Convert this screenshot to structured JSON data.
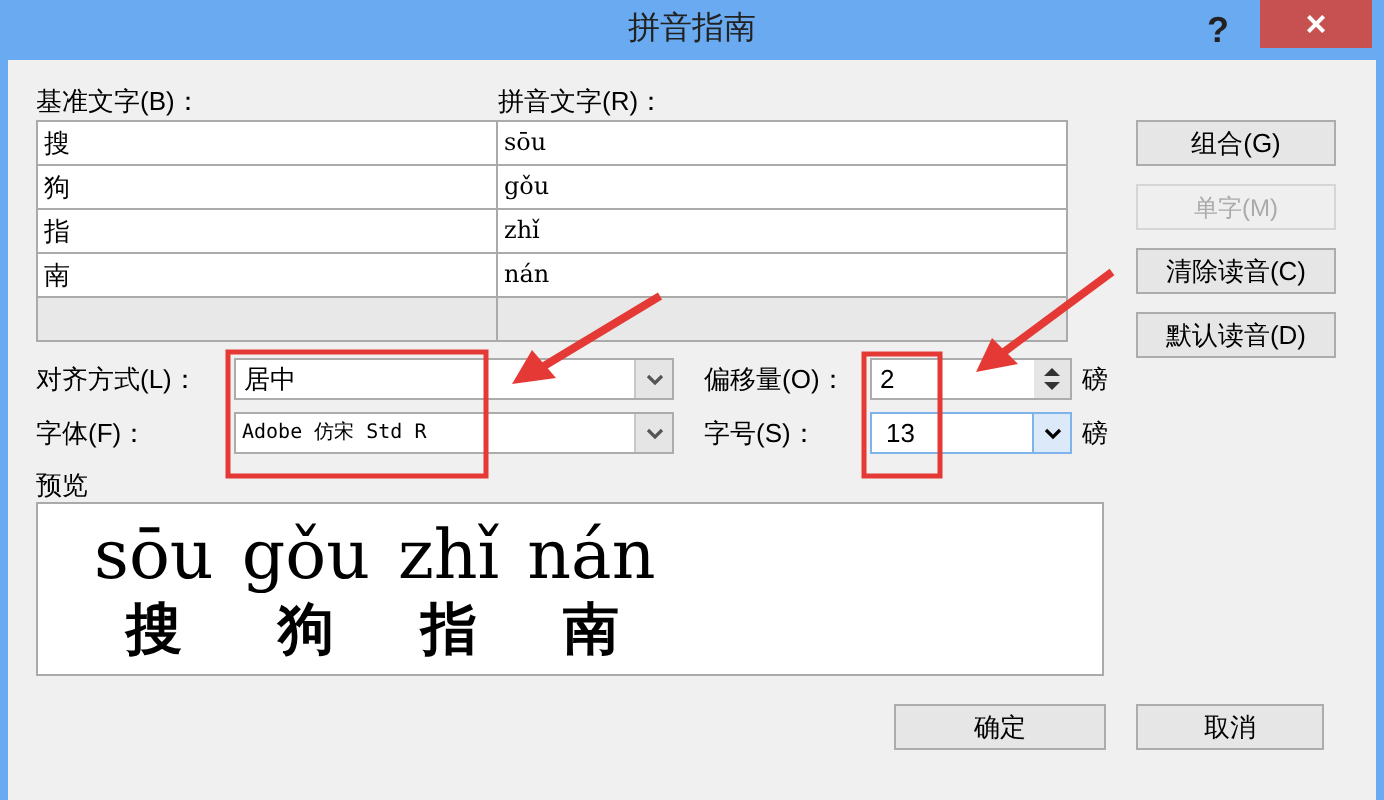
{
  "window": {
    "title": "拼音指南",
    "help": "?",
    "close": "×"
  },
  "columns": {
    "base": "基准文字(B)：",
    "ruby": "拼音文字(R)："
  },
  "rows": [
    {
      "base": "搜",
      "ruby": "sōu"
    },
    {
      "base": "狗",
      "ruby": "gǒu"
    },
    {
      "base": "指",
      "ruby": "zhǐ"
    },
    {
      "base": "南",
      "ruby": "nán"
    }
  ],
  "side_buttons": [
    {
      "label": "组合(G)",
      "disabled": false
    },
    {
      "label": "单字(M)",
      "disabled": true
    },
    {
      "label": "清除读音(C)",
      "disabled": false
    },
    {
      "label": "默认读音(D)",
      "disabled": false
    }
  ],
  "alignment": {
    "label": "对齐方式(L)：",
    "value": "居中"
  },
  "font": {
    "label": "字体(F)：",
    "value": "Adobe 仿宋 Std R"
  },
  "offset": {
    "label": "偏移量(O)：",
    "value": "2",
    "unit": "磅"
  },
  "size": {
    "label": "字号(S)：",
    "value": "13",
    "unit": "磅"
  },
  "preview": {
    "label": "预览",
    "items": [
      {
        "pinyin": "sōu",
        "character": "搜"
      },
      {
        "pinyin": "gǒu",
        "character": "狗"
      },
      {
        "pinyin": "zhǐ",
        "character": "指"
      },
      {
        "pinyin": "nán",
        "character": "南"
      }
    ]
  },
  "buttons": [
    {
      "label": "确定"
    },
    {
      "label": "取消"
    }
  ]
}
